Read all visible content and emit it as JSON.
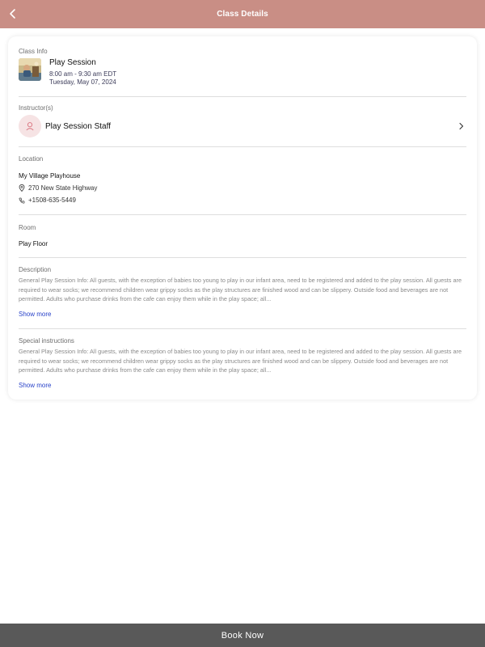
{
  "header": {
    "title": "Class Details",
    "back_icon": "chevron-left-icon"
  },
  "class_info": {
    "label": "Class Info",
    "name": "Play Session",
    "time": "8:00 am - 9:30 am EDT",
    "date": "Tuesday, May 07, 2024"
  },
  "instructor": {
    "label": "Instructor(s)",
    "name": "Play Session Staff",
    "avatar_icon": "person-icon",
    "chevron_icon": "chevron-right-icon"
  },
  "location": {
    "label": "Location",
    "name": "My Village Playhouse",
    "address": "270 New State Highway",
    "phone": "+1508-635-5449"
  },
  "room": {
    "label": "Room",
    "name": "Play Floor"
  },
  "description": {
    "label": "Description",
    "text": "General Play Session Info: All guests, with the exception of babies too young to play in our infant area, need to be registered and added to the play session.  All guests are required to wear socks; we recommend children wear grippy socks as the play structures are finished wood and can be slippery.  Outside food and beverages are not permitted. Adults who purchase drinks from the cafe can enjoy them while in the play space; all...",
    "show_more": "Show more"
  },
  "special_instructions": {
    "label": "Special instructions",
    "text": "General Play Session Info: All guests, with the exception of babies too young to play in our infant area, need to be registered and added to the play session.  All guests are required to wear socks; we recommend children wear grippy socks as the play structures are finished wood and can be slippery.  Outside food and beverages are not permitted. Adults who purchase drinks from the cafe can enjoy them while in the play space; all...",
    "show_more": "Show more"
  },
  "footer": {
    "book_label": "Book Now"
  },
  "colors": {
    "header_bg": "#c98e85",
    "footer_bg": "#595959",
    "link": "#2a43c9",
    "avatar_bg": "#f6e3e4",
    "avatar_icon": "#d9717d"
  }
}
